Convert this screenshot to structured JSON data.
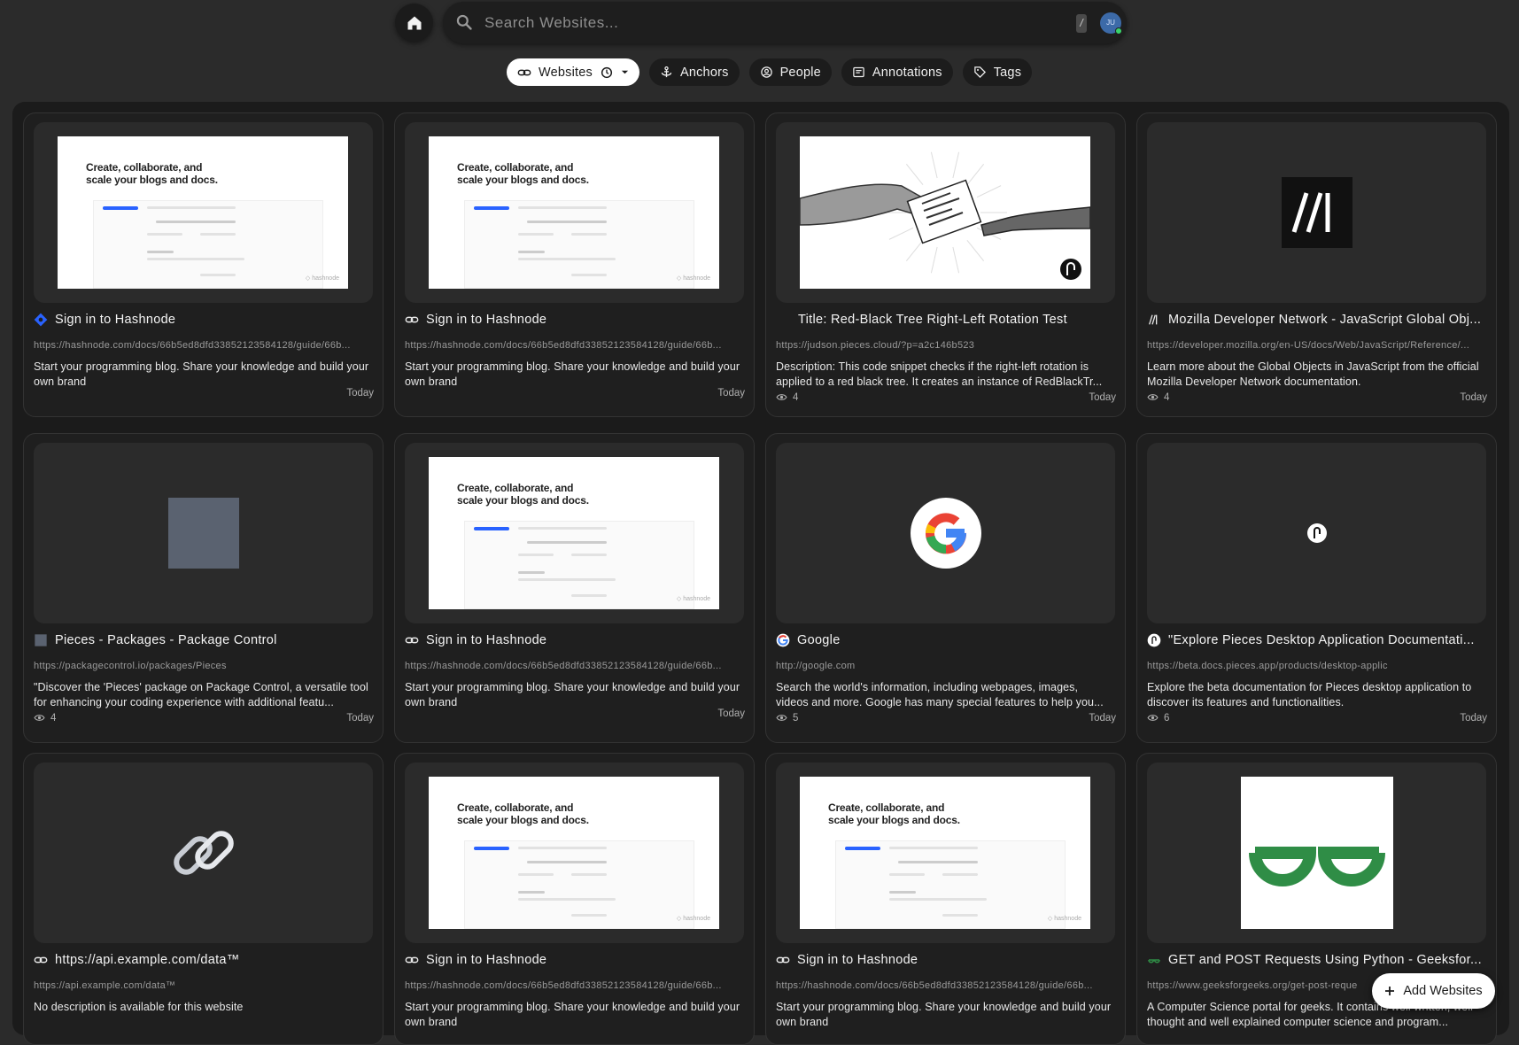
{
  "search": {
    "placeholder": "Search Websites...",
    "shortcut": "/",
    "avatar_initials": "JU"
  },
  "filters": [
    {
      "label": "Websites",
      "active": true
    },
    {
      "label": "Anchors",
      "active": false
    },
    {
      "label": "People",
      "active": false
    },
    {
      "label": "Annotations",
      "active": false
    },
    {
      "label": "Tags",
      "active": false
    }
  ],
  "shot_text": {
    "headline": "Create, collaborate, and scale your blogs and docs.",
    "watermark": "hashnode"
  },
  "cards": [
    {
      "title": "Sign in to Hashnode",
      "url": "https://hashnode.com/docs/66b5ed8dfd33852123584128/guide/66b...",
      "desc": "Start your programming blog. Share your knowledge and build your own brand",
      "views": "",
      "date": "Today",
      "icon": "hashnode-icon",
      "thumb": "hashnode"
    },
    {
      "title": "Sign in to Hashnode",
      "url": "https://hashnode.com/docs/66b5ed8dfd33852123584128/guide/66b...",
      "desc": "Start your programming blog. Share your knowledge and build your own brand",
      "views": "",
      "date": "Today",
      "icon": "link-icon",
      "thumb": "hashnode"
    },
    {
      "title": "Title: Red-Black Tree Right-Left Rotation Test",
      "url": "https://judson.pieces.cloud/?p=a2c146b523",
      "desc": "Description: This code snippet checks if the right-left rotation is applied to a red black tree. It creates an instance of RedBlackTr...",
      "views": "4",
      "date": "Today",
      "icon": "none",
      "thumb": "pieces-art"
    },
    {
      "title": "Mozilla Developer Network - JavaScript Global Obj...",
      "url": "https://developer.mozilla.org/en-US/docs/Web/JavaScript/Reference/...",
      "desc": "Learn more about the Global Objects in JavaScript from the official Mozilla Developer Network documentation.",
      "views": "4",
      "date": "Today",
      "icon": "mdn-icon",
      "thumb": "mdn"
    },
    {
      "title": "Pieces - Packages - Package Control",
      "url": "https://packagecontrol.io/packages/Pieces",
      "desc": "\"Discover the 'Pieces' package on Package Control, a versatile tool for enhancing your coding experience with additional featu...",
      "views": "4",
      "date": "Today",
      "icon": "package-icon",
      "thumb": "gray"
    },
    {
      "title": "Sign in to Hashnode",
      "url": "https://hashnode.com/docs/66b5ed8dfd33852123584128/guide/66b...",
      "desc": "Start your programming blog. Share your knowledge and build your own brand",
      "views": "",
      "date": "Today",
      "icon": "link-icon",
      "thumb": "hashnode"
    },
    {
      "title": "Google",
      "url": "http://google.com",
      "desc": "Search the world's information, including webpages, images, videos and more. Google has many special features to help you...",
      "views": "5",
      "date": "Today",
      "icon": "google-icon",
      "thumb": "google"
    },
    {
      "title": "\"Explore Pieces Desktop Application Documentati...",
      "url": "https://beta.docs.pieces.app/products/desktop-applic",
      "desc": "Explore the beta documentation for Pieces desktop application to discover its features and functionalities.",
      "views": "6",
      "date": "Today",
      "icon": "pieces-icon",
      "thumb": "pieces-logo"
    },
    {
      "title": "https://api.example.com/data™",
      "url": "https://api.example.com/data™",
      "desc": "No description is available for this website",
      "views": "",
      "date": "",
      "icon": "link-icon",
      "thumb": "chain"
    },
    {
      "title": "Sign in to Hashnode",
      "url": "https://hashnode.com/docs/66b5ed8dfd33852123584128/guide/66b...",
      "desc": "Start your programming blog. Share your knowledge and build your own brand",
      "views": "",
      "date": "",
      "icon": "link-icon",
      "thumb": "hashnode"
    },
    {
      "title": "Sign in to Hashnode",
      "url": "https://hashnode.com/docs/66b5ed8dfd33852123584128/guide/66b...",
      "desc": "Start your programming blog. Share your knowledge and build your own brand",
      "views": "",
      "date": "",
      "icon": "link-icon",
      "thumb": "hashnode"
    },
    {
      "title": "GET and POST Requests Using Python - Geeksfor...",
      "url": "https://www.geeksforgeeks.org/get-post-reque",
      "desc": "A Computer Science portal for geeks. It contains well written, well thought and well explained computer science and program...",
      "views": "",
      "date": "",
      "icon": "gfg-icon",
      "thumb": "gfg"
    }
  ],
  "add_button": {
    "label": "Add Websites"
  },
  "colors": {
    "background": "#2b2b2b",
    "panel": "#1b1b1b",
    "card": "#1f1f1f",
    "accent": "#ffffff",
    "gfg_green": "#2f8d46"
  }
}
